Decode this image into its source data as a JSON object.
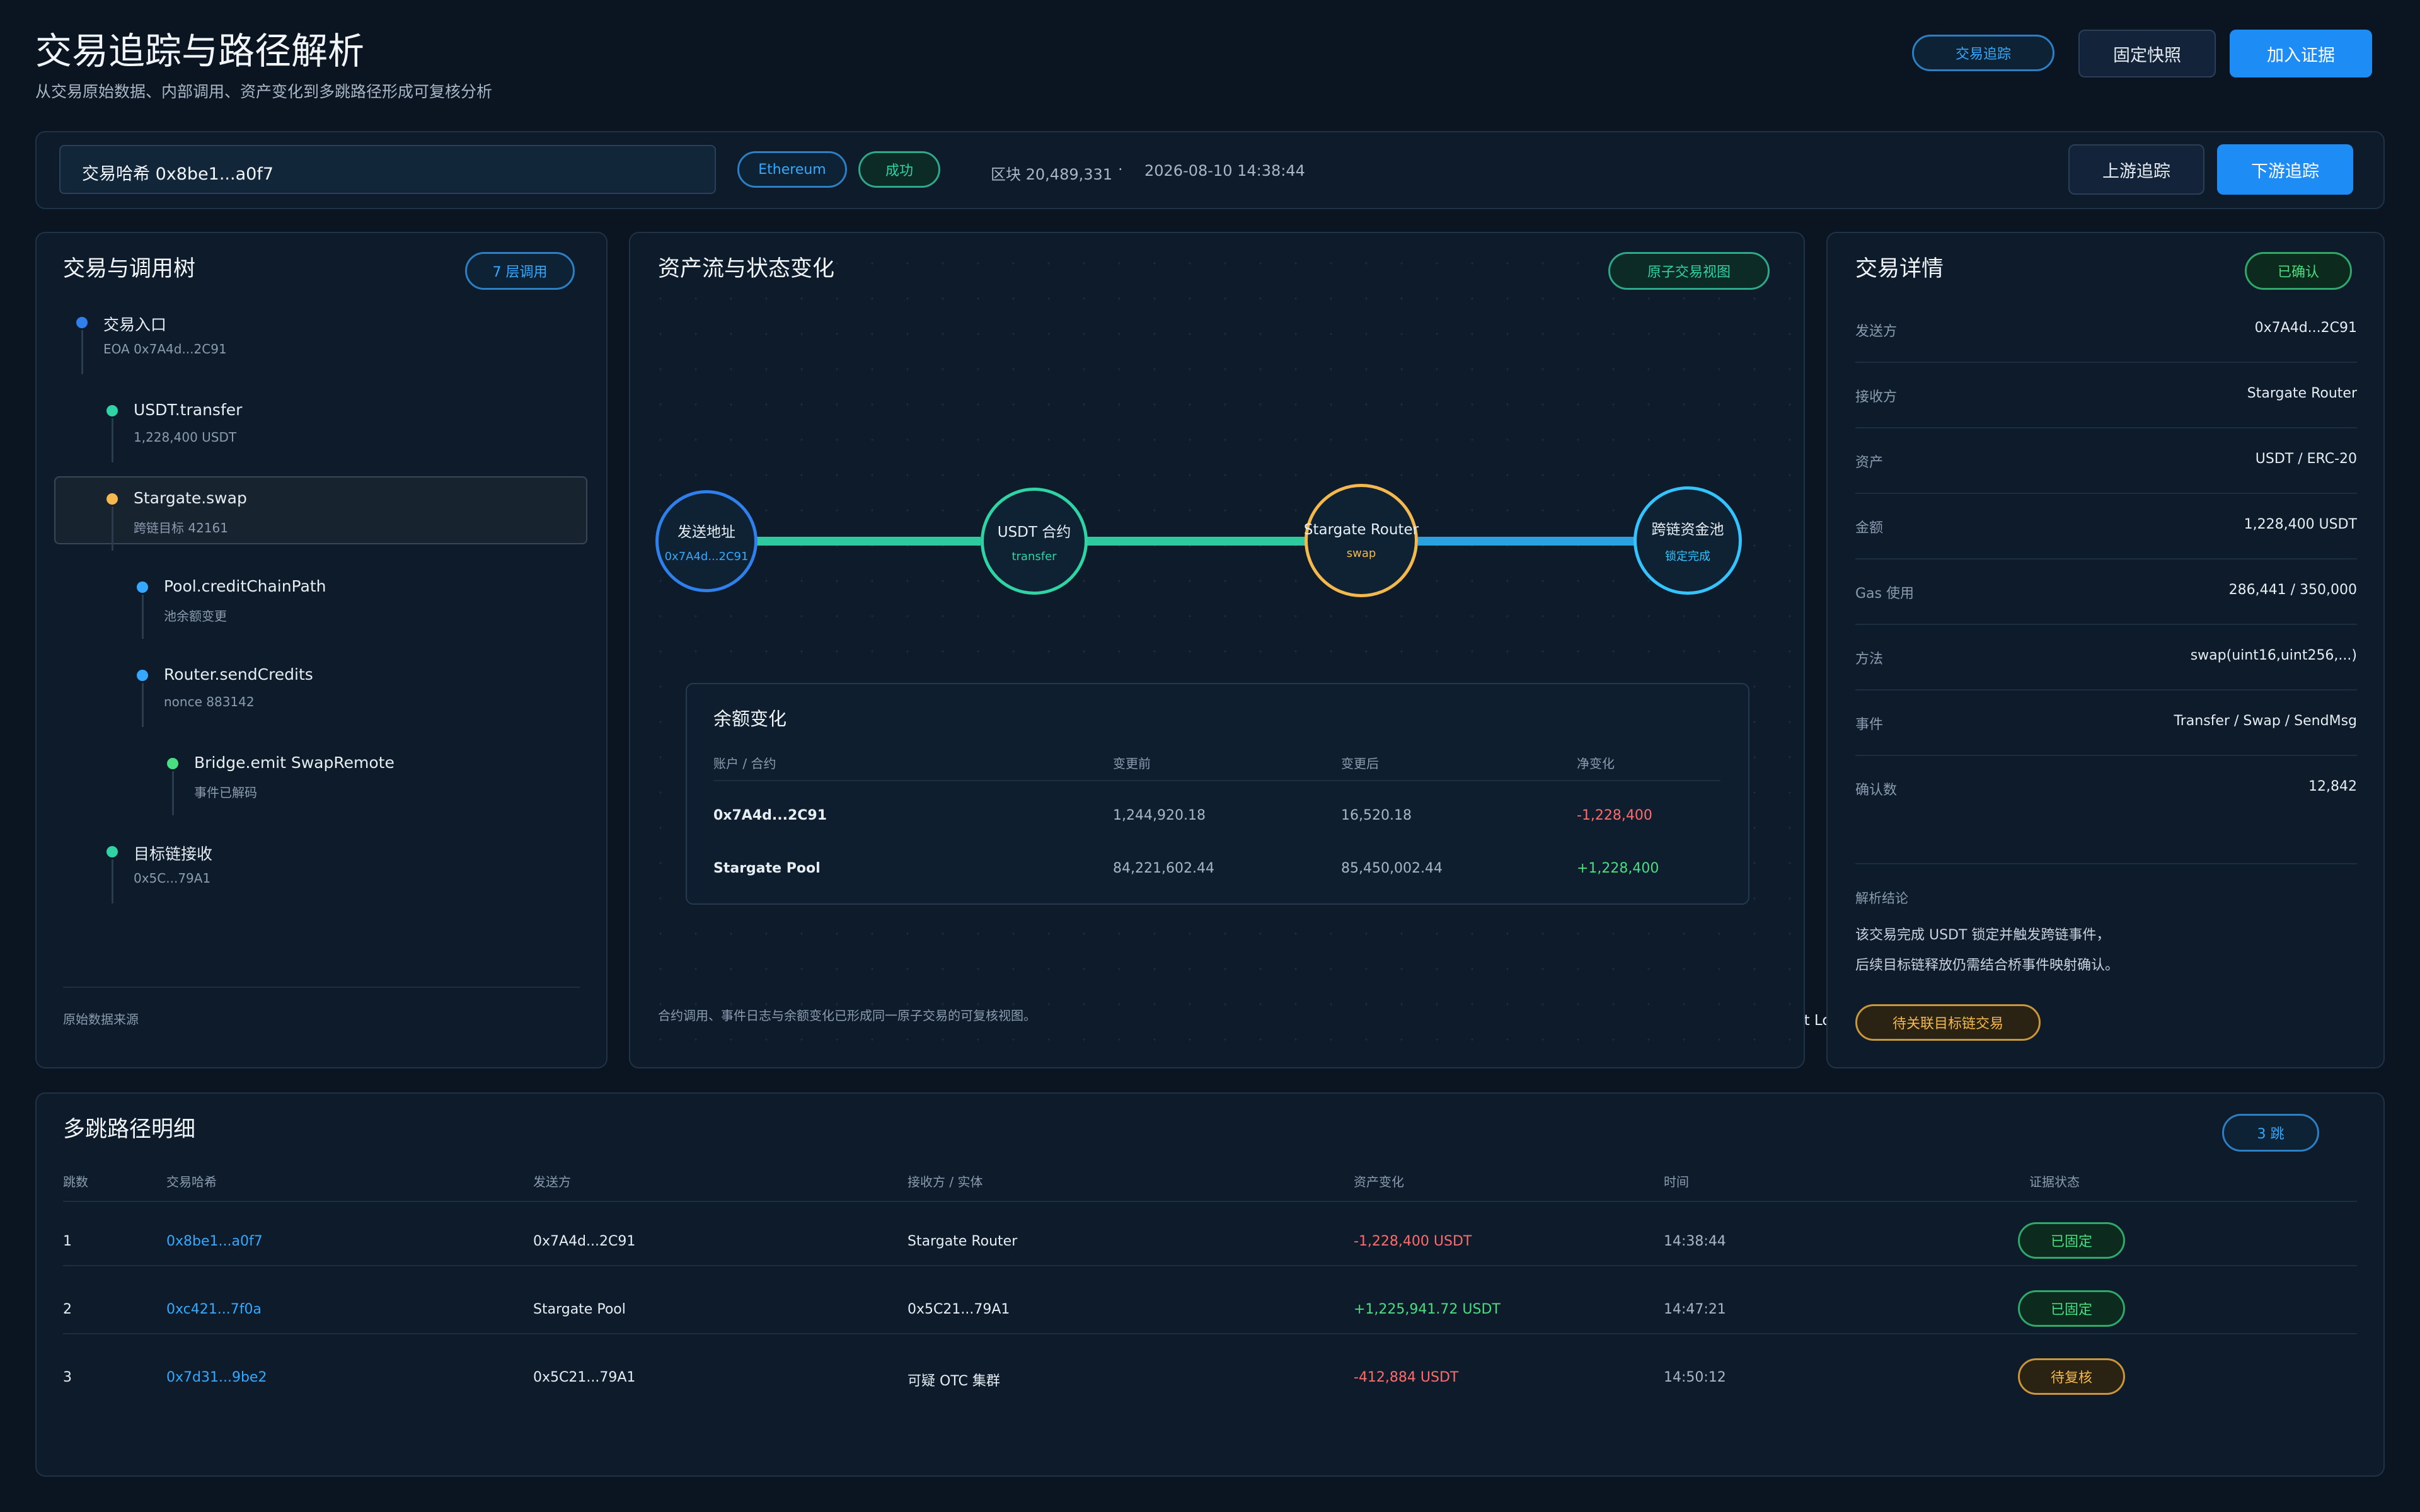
{
  "header": {
    "title": "交易追踪与路径解析",
    "subtitle": "从交易原始数据、内部调用、资产变化到多跳路径形成可复核分析",
    "mode_pill": "交易追踪",
    "snapshot_button": "固定快照",
    "evidence_button": "加入证据"
  },
  "search": {
    "tx_hash": "交易哈希 0x8be1...a0f7",
    "chain_badge": "Ethereum",
    "status_badge": "成功",
    "block": "区块 20,489,331",
    "separator": "·",
    "timestamp": "2026-08-10 14:38:44",
    "upstream_button": "上游追踪",
    "downstream_button": "下游追踪"
  },
  "call_tree": {
    "title": "交易与调用树",
    "depth_badge": "7 层调用",
    "nodes": [
      {
        "title": "交易入口",
        "sub": "EOA 0x7A4d...2C91",
        "color": "#2f80ed"
      },
      {
        "title": "USDT.transfer",
        "sub": "1,228,400 USDT",
        "color": "#2fd3a4"
      },
      {
        "title": "Stargate.swap",
        "sub": "跨链目标 42161",
        "color": "#f5b84d"
      },
      {
        "title": "Pool.creditChainPath",
        "sub": "池余额变更",
        "color": "#35a9ff"
      },
      {
        "title": "Router.sendCredits",
        "sub": "nonce 883142",
        "color": "#35a9ff"
      },
      {
        "title": "Bridge.emit SwapRemote",
        "sub": "事件已解码",
        "color": "#4ade80"
      },
      {
        "title": "目标链接收",
        "sub": "0x5C...79A1",
        "color": "#2fd3a4"
      }
    ],
    "footer_label": "原始数据来源",
    "footer_value": "全节点 / Trace / Event Log"
  },
  "asset_flow": {
    "title": "资产流与状态变化",
    "view_badge": "原子交易视图",
    "nodes": [
      {
        "title": "发送地址",
        "sub": "0x7A4d...2C91",
        "color": "#2f80ed",
        "sub_color": "#35a9ff"
      },
      {
        "title": "USDT 合约",
        "sub": "transfer",
        "color": "#2fd3a4",
        "sub_color": "#2fd3a4"
      },
      {
        "title": "Stargate Router",
        "sub": "swap",
        "color": "#f5b84d",
        "sub_color": "#f5b84d"
      },
      {
        "title": "跨链资金池",
        "sub": "锁定完成",
        "color": "#35c3ff",
        "sub_color": "#35c3ff"
      }
    ],
    "balance": {
      "title": "余额变化",
      "headers": [
        "账户 / 合约",
        "变更前",
        "变更后",
        "净变化"
      ],
      "rows": [
        {
          "account": "0x7A4d...2C91",
          "before": "1,244,920.18",
          "after": "16,520.18",
          "delta": "-1,228,400",
          "sign": "neg"
        },
        {
          "account": "Stargate Pool",
          "before": "84,221,602.44",
          "after": "85,450,002.44",
          "delta": "+1,228,400",
          "sign": "pos"
        }
      ]
    },
    "note": "合约调用、事件日志与余额变化已形成同一原子交易的可复核视图。"
  },
  "details": {
    "title": "交易详情",
    "status_badge": "已确认",
    "rows": [
      {
        "label": "发送方",
        "value": "0x7A4d...2C91"
      },
      {
        "label": "接收方",
        "value": "Stargate Router"
      },
      {
        "label": "资产",
        "value": "USDT / ERC-20"
      },
      {
        "label": "金额",
        "value": "1,228,400 USDT"
      },
      {
        "label": "Gas 使用",
        "value": "286,441 / 350,000"
      },
      {
        "label": "方法",
        "value": "swap(uint16,uint256,...)"
      },
      {
        "label": "事件",
        "value": "Transfer / Swap / SendMsg"
      },
      {
        "label": "确认数",
        "value": "12,842"
      }
    ],
    "conclusion_label": "解析结论",
    "conclusion_line1": "该交易完成 USDT 锁定并触发跨链事件，",
    "conclusion_line2": "后续目标链释放仍需结合桥事件映射确认。",
    "pending_button": "待关联目标链交易"
  },
  "hops": {
    "title": "多跳路径明细",
    "count_badge": "3 跳",
    "headers": [
      "跳数",
      "交易哈希",
      "发送方",
      "接收方 / 实体",
      "资产变化",
      "时间",
      "证据状态"
    ],
    "rows": [
      {
        "hop": "1",
        "hash": "0x8be1...a0f7",
        "from": "0x7A4d...2C91",
        "to": "Stargate Router",
        "change": "-1,228,400 USDT",
        "sign": "neg",
        "time": "14:38:44",
        "status": "已固定",
        "status_type": "ok"
      },
      {
        "hop": "2",
        "hash": "0xc421...7f0a",
        "from": "Stargate Pool",
        "to": "0x5C21...79A1",
        "change": "+1,225,941.72 USDT",
        "sign": "pos",
        "time": "14:47:21",
        "status": "已固定",
        "status_type": "ok"
      },
      {
        "hop": "3",
        "hash": "0x7d31...9be2",
        "from": "0x5C21...79A1",
        "to": "可疑 OTC 集群",
        "change": "-412,884 USDT",
        "sign": "neg",
        "time": "14:50:12",
        "status": "待复核",
        "status_type": "warn"
      }
    ]
  }
}
